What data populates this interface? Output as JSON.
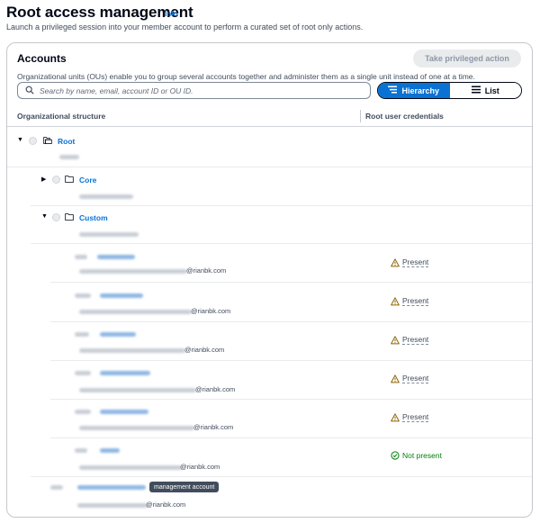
{
  "page": {
    "title": "Root access management",
    "info_label": "Info",
    "description": "Launch a privileged session into your member account to perform a curated set of root only actions."
  },
  "accounts_panel": {
    "title": "Accounts",
    "take_action_label": "Take privileged action",
    "description": "Organizational units (OUs) enable you to group several accounts together and administer them as a single unit instead of one at a time.",
    "search": {
      "placeholder": "Search by name, email, account ID or OU ID.",
      "value": ""
    },
    "view_toggle": {
      "hierarchy_label": "Hierarchy",
      "list_label": "List",
      "selected": "Hierarchy"
    },
    "columns": {
      "structure": "Organizational structure",
      "root_credentials": "Root user credentials"
    }
  },
  "tree": {
    "root": {
      "name": "Root",
      "expanded": true
    },
    "ous": [
      {
        "name": "Core",
        "expanded": false
      },
      {
        "name": "Custom",
        "expanded": true
      }
    ],
    "accounts": [
      {
        "email_suffix": "@rianbk.com",
        "status": "Present"
      },
      {
        "email_suffix": "@rianbk.com",
        "status": "Present"
      },
      {
        "email_suffix": "@rianbk.com",
        "status": "Present"
      },
      {
        "email_suffix": "@rianbk.com",
        "status": "Present"
      },
      {
        "email_suffix": "@rianbk.com",
        "status": "Present"
      },
      {
        "email_suffix": "@rianbk.com",
        "status": "Not present"
      }
    ],
    "management_account": {
      "badge": "management account",
      "email_suffix": "@rianbk.com"
    }
  },
  "colors": {
    "accent": "#0972d3",
    "warning": "#8d6605",
    "success": "#037f0c"
  },
  "icons": [
    "info-link",
    "search-icon",
    "hierarchy-icon",
    "list-icon",
    "folder-icon",
    "warning-icon",
    "check-circle-icon",
    "caret-down-icon",
    "caret-right-icon"
  ]
}
